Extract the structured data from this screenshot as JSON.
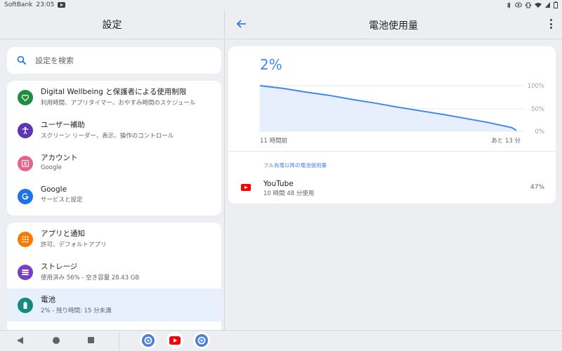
{
  "status_bar": {
    "carrier": "SoftBank",
    "time": "23:05",
    "icons": [
      "bluetooth-icon",
      "eye-comfort-icon",
      "vibrate-icon",
      "wifi-icon",
      "battery-icon"
    ]
  },
  "left_panel": {
    "title": "設定",
    "search": {
      "placeholder": "設定を検索",
      "icon": "search-icon"
    },
    "items": [
      {
        "title": "Digital Wellbeing と保護者による使用制限",
        "subtitle": "利用時間、アプリタイマー、おやすみ時間のスケジュール",
        "icon": "wellbeing-icon",
        "color": "#1e8e3e"
      },
      {
        "title": "ユーザー補助",
        "subtitle": "スクリーン リーダー、表示、操作のコントロール",
        "icon": "accessibility-icon",
        "color": "#5e35b1"
      },
      {
        "title": "アカウント",
        "subtitle": "Google",
        "icon": "account-icon",
        "color": "#e8628a"
      },
      {
        "title": "Google",
        "subtitle": "サービスと設定",
        "icon": "google-icon",
        "color": "#1a73e8"
      },
      {
        "title": "アプリと通知",
        "subtitle": "許可、デフォルトアプリ",
        "icon": "apps-icon",
        "color": "#f57c00"
      },
      {
        "title": "ストレージ",
        "subtitle": "使用済み 56% - 空き容量 28.43 GB",
        "icon": "storage-icon",
        "color": "#7b3fc4"
      },
      {
        "title": "電池",
        "subtitle": "2% - 残り時間: 15 分未満",
        "icon": "battery-icon",
        "color": "#128c7e"
      }
    ]
  },
  "right_panel": {
    "title": "電池使用量",
    "battery_percent": "2%",
    "chart_axis": {
      "y_100": "100%",
      "y_50": "50%",
      "y_0": "0%",
      "x_start": "11 時間前",
      "x_end": "あと 13 分"
    },
    "section_label": "フル充電以降の電池使用量",
    "apps": [
      {
        "name": "YouTube",
        "detail": "10 時間 48 分使用",
        "percent": "47%"
      }
    ]
  },
  "chart_data": {
    "type": "area",
    "x": [
      0,
      1,
      2,
      3,
      4,
      5,
      6,
      7,
      8,
      9,
      10,
      11,
      11.2
    ],
    "values": [
      100,
      94,
      86,
      79,
      70,
      62,
      53,
      45,
      37,
      28,
      19,
      8,
      2
    ],
    "ylim": [
      0,
      100
    ],
    "title": "",
    "xlabel": "",
    "ylabel": "",
    "x_tick_labels": [
      "11 時間前",
      "あと 13 分"
    ],
    "y_tick_labels": [
      "100%",
      "50%",
      "0%"
    ],
    "grid": true,
    "colors": {
      "line": "#4285f4",
      "fill": "#e8effc"
    }
  },
  "nav": {
    "dock": [
      "settings-app-icon",
      "youtube-app-icon",
      "settings-app-icon"
    ]
  }
}
